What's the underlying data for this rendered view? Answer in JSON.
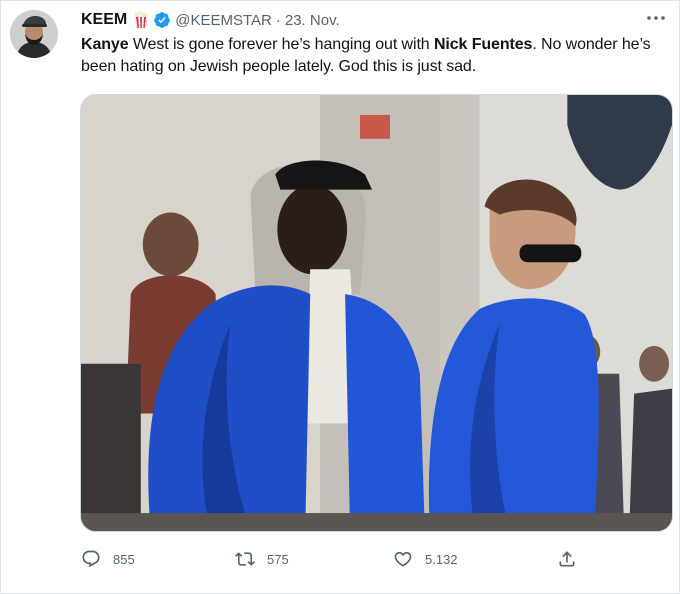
{
  "tweet": {
    "display_name": "KEEM",
    "handle": "@KEEMSTAR",
    "separator": "·",
    "date": "23. Nov.",
    "text_parts": [
      "Kanye",
      " West is gone forever he’s hanging out with ",
      "Nick Fuentes",
      ". No wonder he’s been hating on Jewish people lately. God this is just sad."
    ],
    "stats": {
      "replies": "855",
      "retweets": "575",
      "likes": "5.132"
    }
  },
  "icons": {
    "more": "more-horizontal-icon",
    "popcorn": "popcorn-emoji-icon",
    "verified": "verified-badge-icon",
    "reply": "reply-icon",
    "retweet": "retweet-icon",
    "like": "like-icon",
    "share": "share-icon"
  },
  "colors": {
    "text": "#0f1419",
    "secondary": "#536471",
    "verified_blue": "#1d9bf0",
    "border": "#cfd9de"
  }
}
